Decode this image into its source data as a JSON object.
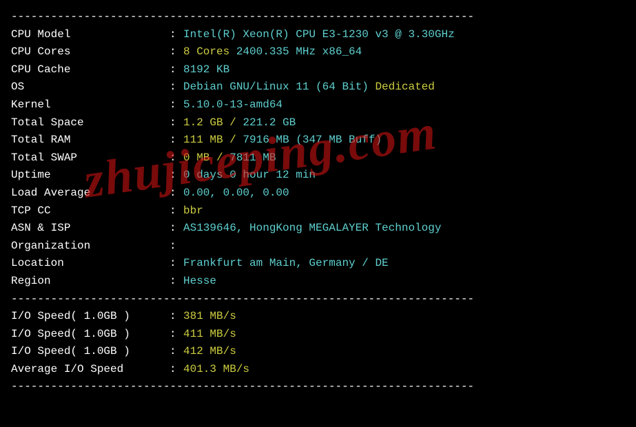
{
  "divider": "----------------------------------------------------------------------",
  "watermark": "zhujiceping.com",
  "sysinfo": [
    {
      "label": "CPU Model",
      "parts": [
        {
          "text": "Intel(R) Xeon(R) CPU E3-1230 v3 @ 3.30GHz",
          "cls": "cyan"
        }
      ]
    },
    {
      "label": "CPU Cores",
      "parts": [
        {
          "text": "8 Cores ",
          "cls": "yellow"
        },
        {
          "text": "2400.335 MHz ",
          "cls": "cyan"
        },
        {
          "text": "x86_64",
          "cls": "cyan"
        }
      ]
    },
    {
      "label": "CPU Cache",
      "parts": [
        {
          "text": "8192 KB",
          "cls": "cyan"
        }
      ]
    },
    {
      "label": "OS",
      "parts": [
        {
          "text": "Debian GNU/Linux 11 (64 Bit) ",
          "cls": "cyan"
        },
        {
          "text": "Dedicated",
          "cls": "yellow"
        }
      ]
    },
    {
      "label": "Kernel",
      "parts": [
        {
          "text": "5.10.0-13-amd64",
          "cls": "cyan"
        }
      ]
    },
    {
      "label": "Total Space",
      "parts": [
        {
          "text": "1.2 GB / ",
          "cls": "yellow"
        },
        {
          "text": "221.2 GB",
          "cls": "cyan"
        }
      ]
    },
    {
      "label": "Total RAM",
      "parts": [
        {
          "text": "111 MB / ",
          "cls": "yellow"
        },
        {
          "text": "7916 MB ",
          "cls": "cyan"
        },
        {
          "text": "(347 MB Buff)",
          "cls": "cyan"
        }
      ]
    },
    {
      "label": "Total SWAP",
      "parts": [
        {
          "text": "0 MB / ",
          "cls": "yellow"
        },
        {
          "text": "7811 MB",
          "cls": "cyan"
        }
      ]
    },
    {
      "label": "Uptime",
      "parts": [
        {
          "text": "0 days 0 hour 12 min",
          "cls": "cyan"
        }
      ]
    },
    {
      "label": "Load Average",
      "parts": [
        {
          "text": "0.00, 0.00, 0.00",
          "cls": "cyan"
        }
      ]
    },
    {
      "label": "TCP CC",
      "parts": [
        {
          "text": "bbr",
          "cls": "yellow"
        }
      ]
    },
    {
      "label": "ASN & ISP",
      "parts": [
        {
          "text": "AS139646, HongKong MEGALAYER Technology",
          "cls": "cyan"
        }
      ]
    },
    {
      "label": "Organization",
      "parts": [
        {
          "text": "",
          "cls": "cyan"
        }
      ]
    },
    {
      "label": "Location",
      "parts": [
        {
          "text": "Frankfurt am Main, Germany / DE",
          "cls": "cyan"
        }
      ]
    },
    {
      "label": "Region",
      "parts": [
        {
          "text": "Hesse",
          "cls": "cyan"
        }
      ]
    }
  ],
  "iospeed": [
    {
      "label": "I/O Speed( 1.0GB )",
      "parts": [
        {
          "text": "381 MB/s",
          "cls": "yellow"
        }
      ]
    },
    {
      "label": "I/O Speed( 1.0GB )",
      "parts": [
        {
          "text": "411 MB/s",
          "cls": "yellow"
        }
      ]
    },
    {
      "label": "I/O Speed( 1.0GB )",
      "parts": [
        {
          "text": "412 MB/s",
          "cls": "yellow"
        }
      ]
    },
    {
      "label": "Average I/O Speed",
      "parts": [
        {
          "text": "401.3 MB/s",
          "cls": "yellow"
        }
      ]
    }
  ]
}
